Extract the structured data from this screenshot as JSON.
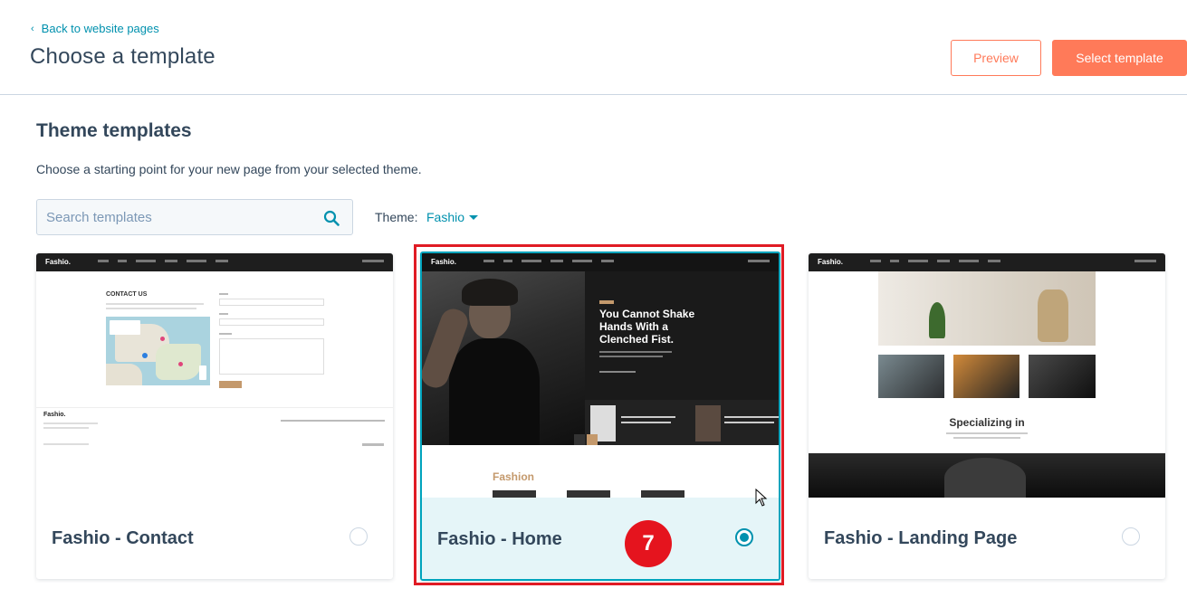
{
  "header": {
    "back_label": "Back to website pages",
    "title": "Choose a template",
    "preview_label": "Preview",
    "select_label": "Select template"
  },
  "section": {
    "title": "Theme templates",
    "subtitle": "Choose a starting point for your new page from your selected theme."
  },
  "search": {
    "placeholder": "Search templates"
  },
  "theme": {
    "label": "Theme:",
    "value": "Fashio"
  },
  "cards": [
    {
      "name": "Fashio - Contact",
      "selected": false,
      "logo": "Fashio.",
      "heading": "CONTACT US",
      "footer_logo": "Fashio."
    },
    {
      "name": "Fashio - Home",
      "selected": true,
      "logo": "Fashio.",
      "hero_text": "You Cannot Shake Hands With a Clenched Fist.",
      "section_label": "Fashion"
    },
    {
      "name": "Fashio - Landing Page",
      "selected": false,
      "logo": "Fashio.",
      "heading": "Specializing in"
    }
  ],
  "annotation": {
    "step": "7"
  },
  "colors": {
    "accent": "#ff7a59",
    "link": "#0091ae",
    "selected_bg": "#e5f5f8",
    "highlight": "#e01b24"
  }
}
